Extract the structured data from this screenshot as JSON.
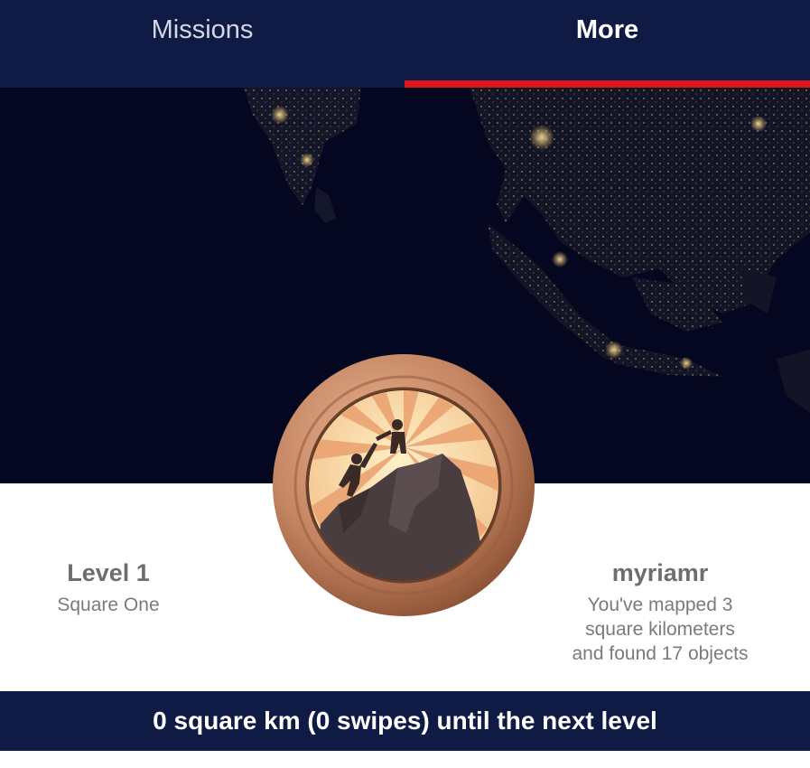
{
  "tabs": [
    {
      "label": "Missions",
      "active": false
    },
    {
      "label": "More",
      "active": true
    }
  ],
  "colors": {
    "navy": "#101b45",
    "accent": "#e0161d",
    "map_background": "#05061f",
    "badge_rim": "#c48562"
  },
  "banner": {
    "icon": "night-earth-map-image"
  },
  "badge": {
    "icon": "climbers-helping-hand-badge-icon",
    "tier": "bronze"
  },
  "level": {
    "title": "Level 1",
    "subtitle": "Square One"
  },
  "profile": {
    "username": "myriamr",
    "stats_line1": "You've mapped 3",
    "stats_line2": "square kilometers",
    "stats_line3": "and found 17 objects"
  },
  "footer": {
    "progress_text": "0 square km (0 swipes) until the next level"
  }
}
